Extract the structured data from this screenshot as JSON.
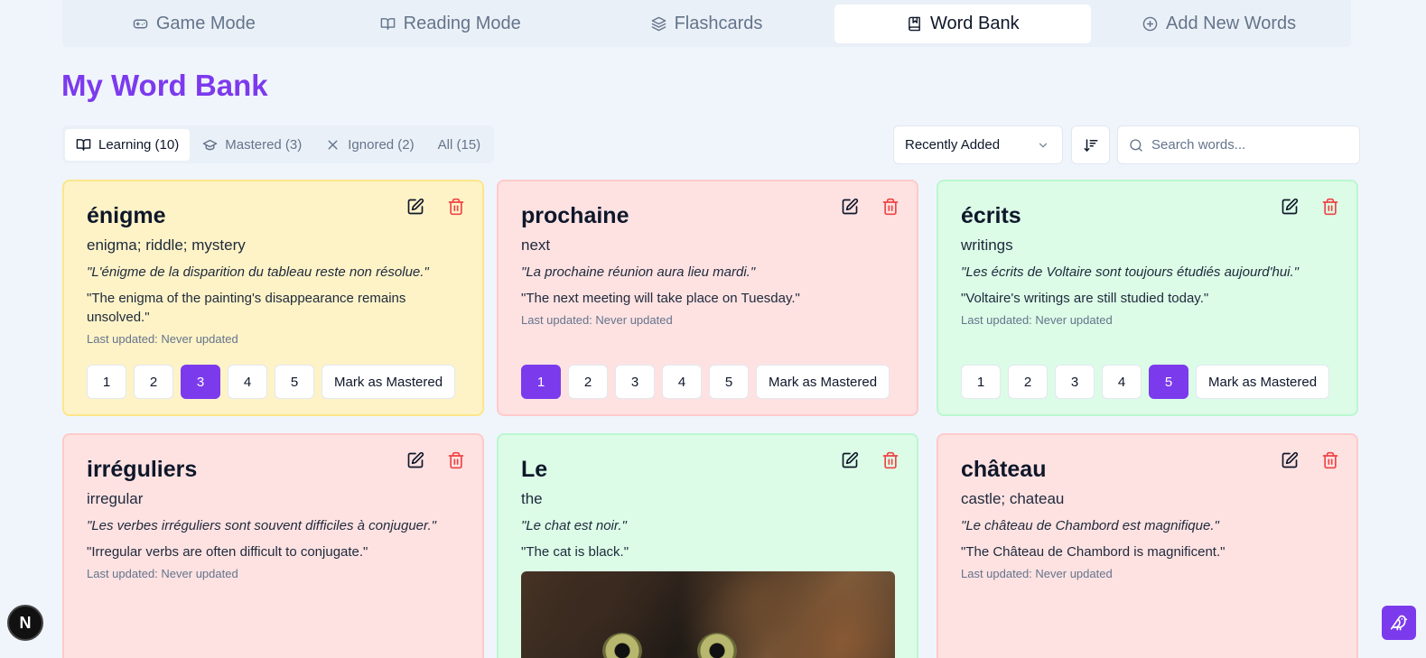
{
  "nav": {
    "tabs": [
      {
        "label": "Game Mode",
        "icon": "gamepad-icon"
      },
      {
        "label": "Reading Mode",
        "icon": "book-open-icon"
      },
      {
        "label": "Flashcards",
        "icon": "layers-icon"
      },
      {
        "label": "Word Bank",
        "icon": "book-marked-icon",
        "active": true
      },
      {
        "label": "Add New Words",
        "icon": "plus-circle-icon"
      }
    ]
  },
  "page_title": "My Word Bank",
  "filters": [
    {
      "label": "Learning (10)",
      "icon": "book-open-icon",
      "active": true
    },
    {
      "label": "Mastered (3)",
      "icon": "graduation-cap-icon"
    },
    {
      "label": "Ignored (2)",
      "icon": "x-icon"
    },
    {
      "label": "All (15)",
      "icon": ""
    }
  ],
  "sort": {
    "selected": "Recently Added"
  },
  "search": {
    "placeholder": "Search words..."
  },
  "level_labels": [
    "1",
    "2",
    "3",
    "4",
    "5"
  ],
  "mark_mastered_label": "Mark as Mastered",
  "cards": [
    {
      "word": "énigme",
      "translation": "enigma; riddle; mystery",
      "example_fr": "\"L'énigme de la disparition du tableau reste non résolue.\"",
      "example_en": "\"The enigma of the painting's disappearance remains unsolved.\"",
      "updated": "Last updated: Never updated",
      "level": 3,
      "color": "#fef3c7"
    },
    {
      "word": "prochaine",
      "translation": "next",
      "example_fr": "\"La prochaine réunion aura lieu mardi.\"",
      "example_en": "\"The next meeting will take place on Tuesday.\"",
      "updated": "Last updated: Never updated",
      "level": 1,
      "color": "#fee2e2"
    },
    {
      "word": "écrits",
      "translation": "writings",
      "example_fr": "\"Les écrits de Voltaire sont toujours étudiés aujourd'hui.\"",
      "example_en": "\"Voltaire's writings are still studied today.\"",
      "updated": "Last updated: Never updated",
      "level": 5,
      "color": "#dcfce7"
    },
    {
      "word": "irréguliers",
      "translation": "irregular",
      "example_fr": "\"Les verbes irréguliers sont souvent difficiles à conjuguer.\"",
      "example_en": "\"Irregular verbs are often difficult to conjugate.\"",
      "updated": "Last updated: Never updated",
      "color": "#fee2e2"
    },
    {
      "word": "Le",
      "translation": "the",
      "example_fr": "\"Le chat est noir.\"",
      "example_en": "\"The cat is black.\"",
      "image": "cat-photo",
      "color": "#dcfce7"
    },
    {
      "word": "château",
      "translation": "castle; chateau",
      "example_fr": "\"Le château de Chambord est magnifique.\"",
      "example_en": "\"The Château de Chambord is magnificent.\"",
      "updated": "Last updated: Never updated",
      "color": "#fee2e2"
    }
  ],
  "colors": {
    "accent": "#7c3aed",
    "delete": "#ef4444"
  },
  "fab_left": "N"
}
